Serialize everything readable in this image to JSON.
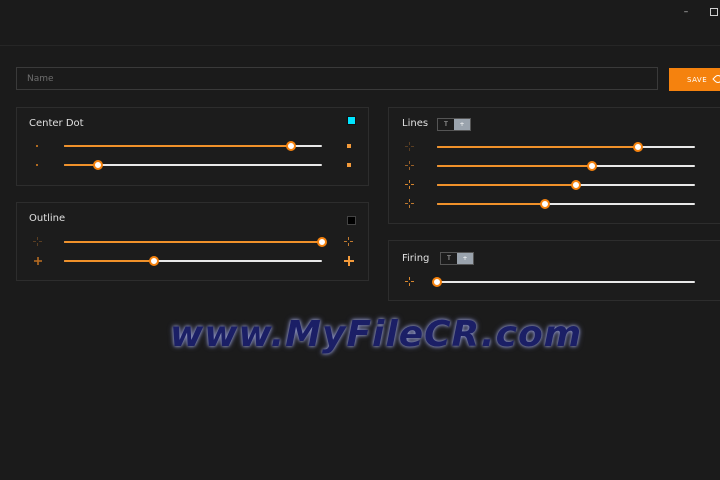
{
  "window": {
    "minimize_glyph": "–",
    "maximize_glyph": ""
  },
  "name_field": {
    "value": "",
    "placeholder": "Name"
  },
  "save_button": {
    "label": "SAVE"
  },
  "panels": {
    "center_dot": {
      "title": "Center Dot",
      "color": "#00e5ff",
      "sliders": [
        0.88,
        0.13
      ]
    },
    "outline": {
      "title": "Outline",
      "color": "#000000",
      "sliders": [
        1.0,
        0.35
      ]
    },
    "lines": {
      "title": "Lines",
      "toggle": [
        "T",
        "+"
      ],
      "sliders": [
        0.78,
        0.6,
        0.54,
        0.42
      ]
    },
    "firing": {
      "title": "Firing",
      "toggle": [
        "T",
        "+"
      ],
      "sliders": [
        0.0
      ]
    }
  },
  "colors": {
    "accent": "#f5820e",
    "background": "#1b1b1b"
  },
  "watermark": "www.MyFileCR.com"
}
